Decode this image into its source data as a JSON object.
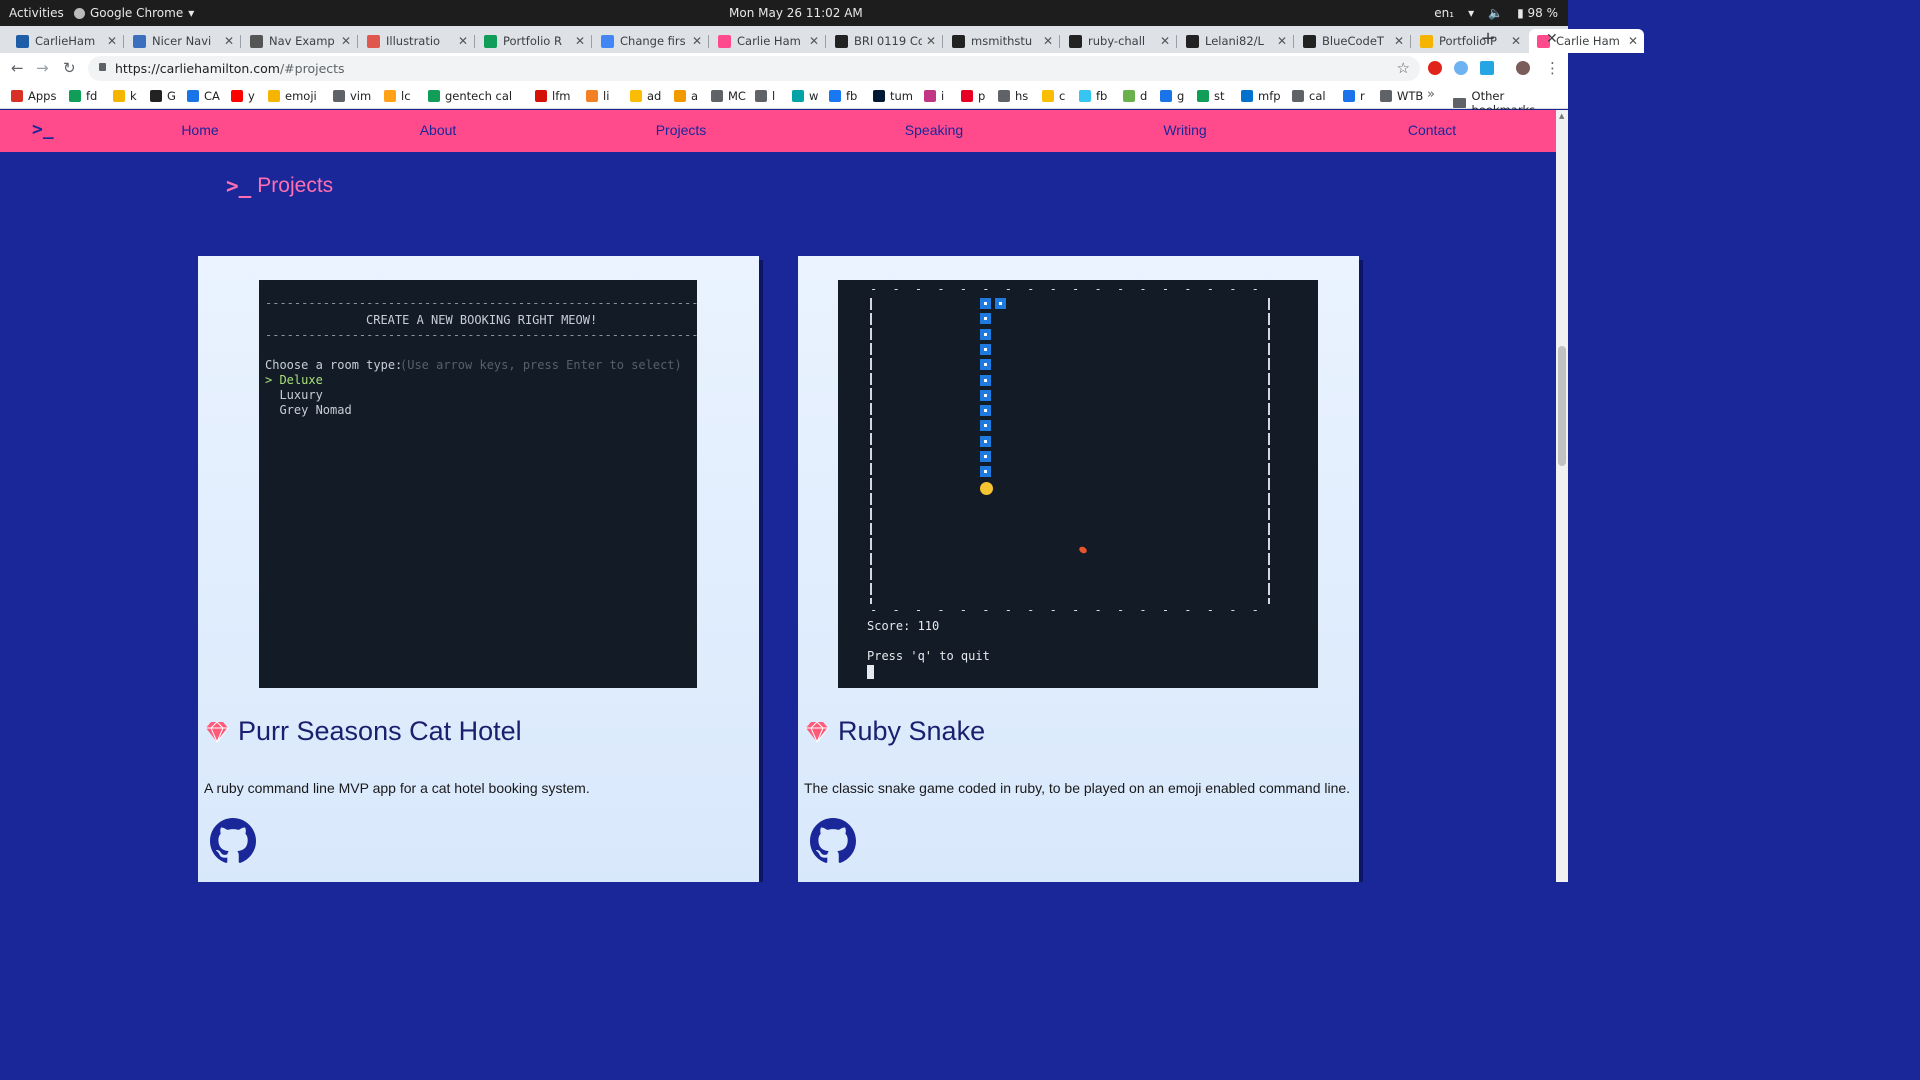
{
  "os_bar": {
    "activities": "Activities",
    "app_name": "Google Chrome",
    "clock": "Mon May 26  11:02 AM",
    "lang": "en₁",
    "battery": "98 %"
  },
  "tabs": [
    {
      "title": "CarlieHam",
      "color": "#1e5ea8"
    },
    {
      "title": "Nicer Navi",
      "color": "#3d6fbf"
    },
    {
      "title": "Nav Examp",
      "color": "#555555"
    },
    {
      "title": "Illustratio",
      "color": "#e0574e"
    },
    {
      "title": "Portfolio R",
      "color": "#0f9d58"
    },
    {
      "title": "Change firs",
      "color": "#4285f4"
    },
    {
      "title": "Carlie Ham",
      "color": "#ff4b8b"
    },
    {
      "title": "BRI 0119 Co",
      "color": "#222222"
    },
    {
      "title": "msmithstu",
      "color": "#222222"
    },
    {
      "title": "ruby-chall",
      "color": "#222222"
    },
    {
      "title": "Lelani82/L",
      "color": "#222222"
    },
    {
      "title": "BlueCodeT",
      "color": "#222222"
    },
    {
      "title": "Portfolio P",
      "color": "#f4b400"
    },
    {
      "title": "Carlie Ham",
      "color": "#ff4b8b",
      "active": true
    }
  ],
  "omnibox": {
    "host": "https://carliehamilton.com",
    "path": "/#projects"
  },
  "bookmarks": [
    {
      "label": "Apps",
      "color": "#d93025"
    },
    {
      "label": "fd",
      "color": "#0f9d58"
    },
    {
      "label": "k",
      "color": "#f4b400"
    },
    {
      "label": "G",
      "color": "#222222"
    },
    {
      "label": "CA",
      "color": "#1a73e8"
    },
    {
      "label": "y",
      "color": "#ff0000"
    },
    {
      "label": "emoji",
      "color": "#f4b400"
    },
    {
      "label": "vim",
      "color": "#5f6368"
    },
    {
      "label": "lc",
      "color": "#ffa116"
    },
    {
      "label": "gentech cal",
      "color": "#0f9d58"
    },
    {
      "label": "lfm",
      "color": "#d51007"
    },
    {
      "label": "li",
      "color": "#f48024"
    },
    {
      "label": "ad",
      "color": "#fbbc04"
    },
    {
      "label": "a",
      "color": "#f29900"
    },
    {
      "label": "MC",
      "color": "#5f6368"
    },
    {
      "label": "l",
      "color": "#5f6368"
    },
    {
      "label": "w",
      "color": "#00a4a6"
    },
    {
      "label": "fb",
      "color": "#1877f2"
    },
    {
      "label": "tum",
      "color": "#001935"
    },
    {
      "label": "i",
      "color": "#c13584"
    },
    {
      "label": "p",
      "color": "#e60023"
    },
    {
      "label": "hs",
      "color": "#5f6368"
    },
    {
      "label": "c",
      "color": "#fbbc04"
    },
    {
      "label": "fb",
      "color": "#36c5f0"
    },
    {
      "label": "d",
      "color": "#6ab04c"
    },
    {
      "label": "g",
      "color": "#1a73e8"
    },
    {
      "label": "st",
      "color": "#0f9d58"
    },
    {
      "label": "mfp",
      "color": "#0072ce"
    },
    {
      "label": "cal",
      "color": "#5f6368"
    },
    {
      "label": "r",
      "color": "#1a73e8"
    },
    {
      "label": "WTB",
      "color": "#5f6368"
    }
  ],
  "bookmarks_more": "»",
  "other_bookmarks": "Other bookmarks",
  "site": {
    "logo": ">_",
    "nav": [
      "Home",
      "About",
      "Projects",
      "Speaking",
      "Writing",
      "Contact"
    ],
    "section_prompt": ">_",
    "section_title": "Projects",
    "accent_color": "#ff4b8b",
    "background_color": "#1a2799"
  },
  "projects": [
    {
      "title": "Purr Seasons Cat Hotel",
      "description": "A ruby command line MVP app for a cat hotel booking system.",
      "terminal": {
        "dashes": "------------------------------------------------------------",
        "heading": "CREATE A NEW BOOKING RIGHT MEOW!",
        "prompt": "Choose a room type:",
        "hint": "(Use arrow keys, press Enter to select)",
        "options": [
          "> Deluxe",
          "  Luxury",
          "  Grey Nomad"
        ]
      }
    },
    {
      "title": "Ruby Snake",
      "description": "The classic snake game coded in ruby, to be played on an emoji enabled command line.",
      "terminal": {
        "border": "- - - - - - - - - - - - - - - - - - - - - - - - - - - - - - - - - -",
        "score": "Score: 110",
        "quit": "Press 'q' to quit"
      }
    }
  ]
}
